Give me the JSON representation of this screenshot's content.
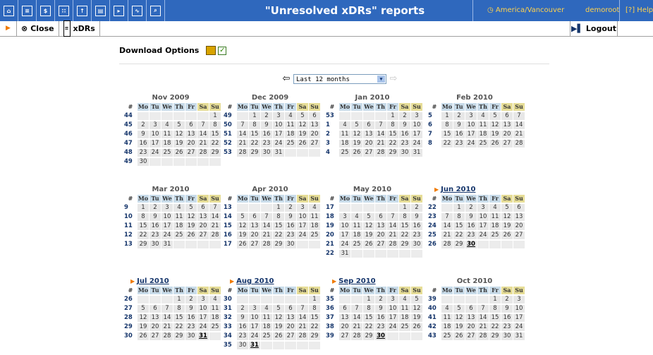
{
  "header": {
    "title": "\"Unresolved xDRs\" reports",
    "timezone": "America/Vancouver",
    "user": "demoroot",
    "help": "Help",
    "nav_icons": [
      "home-icon",
      "list-icon",
      "dollar-icon",
      "grid-icon",
      "upload-icon",
      "report-icon",
      "forward-icon",
      "chart-icon",
      "search-icon"
    ]
  },
  "toolbar": {
    "close_label": "Close",
    "xdrs_label": "xDRs",
    "logout_label": "Logout"
  },
  "download": {
    "label": "Download Options"
  },
  "period": {
    "selected": "Last 12 months"
  },
  "calendar": {
    "day_headers": [
      "#",
      "Mo",
      "Tu",
      "We",
      "Th",
      "Fr",
      "Sa",
      "Su"
    ],
    "months": [
      {
        "title": "Nov 2009",
        "link": false,
        "weeks": [
          [
            "44",
            "",
            "",
            "",
            "",
            "",
            "",
            "1"
          ],
          [
            "45",
            "2",
            "3",
            "4",
            "5",
            "6",
            "7",
            "8"
          ],
          [
            "46",
            "9",
            "10",
            "11",
            "12",
            "13",
            "14",
            "15"
          ],
          [
            "47",
            "16",
            "17",
            "18",
            "19",
            "20",
            "21",
            "22"
          ],
          [
            "48",
            "23",
            "24",
            "25",
            "26",
            "27",
            "28",
            "29"
          ],
          [
            "49",
            "30",
            "",
            "",
            "",
            "",
            "",
            ""
          ]
        ]
      },
      {
        "title": "Dec 2009",
        "link": false,
        "weeks": [
          [
            "49",
            "",
            "1",
            "2",
            "3",
            "4",
            "5",
            "6"
          ],
          [
            "50",
            "7",
            "8",
            "9",
            "10",
            "11",
            "12",
            "13"
          ],
          [
            "51",
            "14",
            "15",
            "16",
            "17",
            "18",
            "19",
            "20"
          ],
          [
            "52",
            "21",
            "22",
            "23",
            "24",
            "25",
            "26",
            "27"
          ],
          [
            "53",
            "28",
            "29",
            "30",
            "31",
            "",
            "",
            ""
          ]
        ]
      },
      {
        "title": "Jan 2010",
        "link": false,
        "weeks": [
          [
            "53",
            "",
            "",
            "",
            "",
            "1",
            "2",
            "3"
          ],
          [
            "1",
            "4",
            "5",
            "6",
            "7",
            "8",
            "9",
            "10"
          ],
          [
            "2",
            "11",
            "12",
            "13",
            "14",
            "15",
            "16",
            "17"
          ],
          [
            "3",
            "18",
            "19",
            "20",
            "21",
            "22",
            "23",
            "24"
          ],
          [
            "4",
            "25",
            "26",
            "27",
            "28",
            "29",
            "30",
            "31"
          ]
        ]
      },
      {
        "title": "Feb 2010",
        "link": false,
        "weeks": [
          [
            "5",
            "1",
            "2",
            "3",
            "4",
            "5",
            "6",
            "7"
          ],
          [
            "6",
            "8",
            "9",
            "10",
            "11",
            "12",
            "13",
            "14"
          ],
          [
            "7",
            "15",
            "16",
            "17",
            "18",
            "19",
            "20",
            "21"
          ],
          [
            "8",
            "22",
            "23",
            "24",
            "25",
            "26",
            "27",
            "28"
          ]
        ]
      },
      {
        "title": "Mar 2010",
        "link": false,
        "weeks": [
          [
            "9",
            "1",
            "2",
            "3",
            "4",
            "5",
            "6",
            "7"
          ],
          [
            "10",
            "8",
            "9",
            "10",
            "11",
            "12",
            "13",
            "14"
          ],
          [
            "11",
            "15",
            "16",
            "17",
            "18",
            "19",
            "20",
            "21"
          ],
          [
            "12",
            "22",
            "23",
            "24",
            "25",
            "26",
            "27",
            "28"
          ],
          [
            "13",
            "29",
            "30",
            "31",
            "",
            "",
            "",
            ""
          ]
        ]
      },
      {
        "title": "Apr 2010",
        "link": false,
        "weeks": [
          [
            "13",
            "",
            "",
            "",
            "1",
            "2",
            "3",
            "4"
          ],
          [
            "14",
            "5",
            "6",
            "7",
            "8",
            "9",
            "10",
            "11"
          ],
          [
            "15",
            "12",
            "13",
            "14",
            "15",
            "16",
            "17",
            "18"
          ],
          [
            "16",
            "19",
            "20",
            "21",
            "22",
            "23",
            "24",
            "25"
          ],
          [
            "17",
            "26",
            "27",
            "28",
            "29",
            "30",
            "",
            ""
          ]
        ]
      },
      {
        "title": "May 2010",
        "link": false,
        "weeks": [
          [
            "17",
            "",
            "",
            "",
            "",
            "",
            "1",
            "2"
          ],
          [
            "18",
            "3",
            "4",
            "5",
            "6",
            "7",
            "8",
            "9"
          ],
          [
            "19",
            "10",
            "11",
            "12",
            "13",
            "14",
            "15",
            "16"
          ],
          [
            "20",
            "17",
            "18",
            "19",
            "20",
            "21",
            "22",
            "23"
          ],
          [
            "21",
            "24",
            "25",
            "26",
            "27",
            "28",
            "29",
            "30"
          ],
          [
            "22",
            "31",
            "",
            "",
            "",
            "",
            "",
            ""
          ]
        ]
      },
      {
        "title": "Jun 2010",
        "link": true,
        "highlight": [
          "30"
        ],
        "weeks": [
          [
            "22",
            "",
            "1",
            "2",
            "3",
            "4",
            "5",
            "6"
          ],
          [
            "23",
            "7",
            "8",
            "9",
            "10",
            "11",
            "12",
            "13"
          ],
          [
            "24",
            "14",
            "15",
            "16",
            "17",
            "18",
            "19",
            "20"
          ],
          [
            "25",
            "21",
            "22",
            "23",
            "24",
            "25",
            "26",
            "27"
          ],
          [
            "26",
            "28",
            "29",
            "30",
            "",
            "",
            "",
            ""
          ]
        ]
      },
      {
        "title": "Jul 2010",
        "link": true,
        "highlight": [
          "31"
        ],
        "weeks": [
          [
            "26",
            "",
            "",
            "",
            "1",
            "2",
            "3",
            "4"
          ],
          [
            "27",
            "5",
            "6",
            "7",
            "8",
            "9",
            "10",
            "11"
          ],
          [
            "28",
            "12",
            "13",
            "14",
            "15",
            "16",
            "17",
            "18"
          ],
          [
            "29",
            "19",
            "20",
            "21",
            "22",
            "23",
            "24",
            "25"
          ],
          [
            "30",
            "26",
            "27",
            "28",
            "29",
            "30",
            "31",
            ""
          ]
        ]
      },
      {
        "title": "Aug 2010",
        "link": true,
        "highlight": [
          "31"
        ],
        "weeks": [
          [
            "30",
            "",
            "",
            "",
            "",
            "",
            "",
            "1"
          ],
          [
            "31",
            "2",
            "3",
            "4",
            "5",
            "6",
            "7",
            "8"
          ],
          [
            "32",
            "9",
            "10",
            "11",
            "12",
            "13",
            "14",
            "15"
          ],
          [
            "33",
            "16",
            "17",
            "18",
            "19",
            "20",
            "21",
            "22"
          ],
          [
            "34",
            "23",
            "24",
            "25",
            "26",
            "27",
            "28",
            "29"
          ],
          [
            "35",
            "30",
            "31",
            "",
            "",
            "",
            "",
            ""
          ]
        ]
      },
      {
        "title": "Sep 2010",
        "link": true,
        "highlight": [
          "30"
        ],
        "weeks": [
          [
            "35",
            "",
            "",
            "1",
            "2",
            "3",
            "4",
            "5"
          ],
          [
            "36",
            "6",
            "7",
            "8",
            "9",
            "10",
            "11",
            "12"
          ],
          [
            "37",
            "13",
            "14",
            "15",
            "16",
            "17",
            "18",
            "19"
          ],
          [
            "38",
            "20",
            "21",
            "22",
            "23",
            "24",
            "25",
            "26"
          ],
          [
            "39",
            "27",
            "28",
            "29",
            "30",
            "",
            "",
            ""
          ]
        ]
      },
      {
        "title": "Oct 2010",
        "link": false,
        "weeks": [
          [
            "39",
            "",
            "",
            "",
            "",
            "1",
            "2",
            "3"
          ],
          [
            "40",
            "4",
            "5",
            "6",
            "7",
            "8",
            "9",
            "10"
          ],
          [
            "41",
            "11",
            "12",
            "13",
            "14",
            "15",
            "16",
            "17"
          ],
          [
            "42",
            "18",
            "19",
            "20",
            "21",
            "22",
            "23",
            "24"
          ],
          [
            "43",
            "25",
            "26",
            "27",
            "28",
            "29",
            "30",
            "31"
          ]
        ]
      }
    ]
  }
}
